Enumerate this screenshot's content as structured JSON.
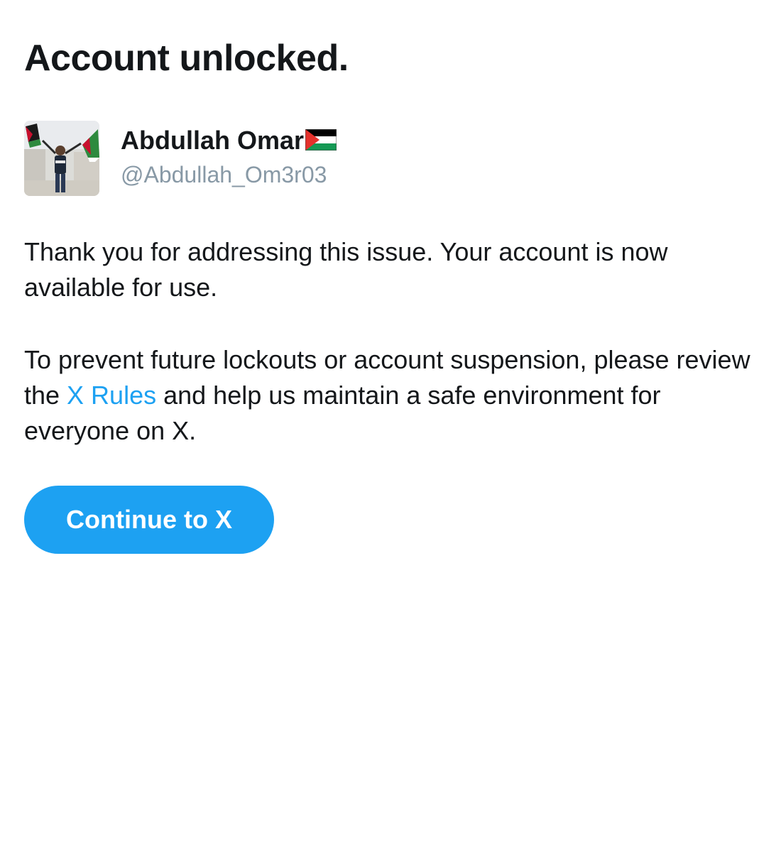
{
  "page": {
    "title": "Account unlocked."
  },
  "profile": {
    "display_name": "Abdullah Omar",
    "handle": "@Abdullah_Om3r03",
    "name_icon": "palestine-flag-icon",
    "avatar_icon": "profile-photo"
  },
  "message": {
    "paragraph1": "Thank you for addressing this issue. Your account is now available for use.",
    "paragraph2_before": "To prevent future lockouts or account suspension, please review the ",
    "paragraph2_link": "X Rules",
    "paragraph2_after": " and help us maintain a safe environment for everyone on X."
  },
  "actions": {
    "continue_label": "Continue to X"
  },
  "colors": {
    "accent": "#1da1f2",
    "text": "#14171a",
    "secondary_text": "#8899a6",
    "background": "#ffffff"
  }
}
